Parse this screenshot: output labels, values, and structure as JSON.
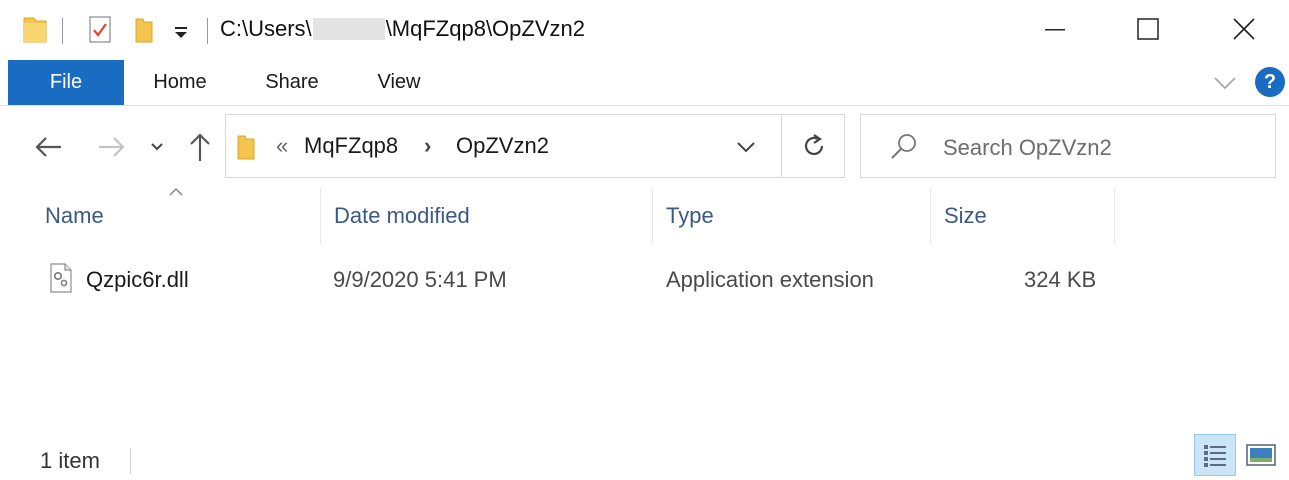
{
  "window": {
    "title_path_prefix": "C:\\Users\\",
    "title_path_suffix": "\\MqFZqp8\\OpZVzn2",
    "minimize_icon": "minimize-icon",
    "maximize_icon": "maximize-icon",
    "close_icon": "close-icon"
  },
  "ribbon": {
    "tabs": [
      {
        "label": "File",
        "active": true
      },
      {
        "label": "Home"
      },
      {
        "label": "Share"
      },
      {
        "label": "View"
      }
    ],
    "help_label": "?"
  },
  "address_bar": {
    "overflow": "«",
    "crumbs": [
      "MqFZqp8",
      "OpZVzn2"
    ],
    "separator": "›"
  },
  "search": {
    "placeholder": "Search OpZVzn2"
  },
  "columns": [
    "Name",
    "Date modified",
    "Type",
    "Size"
  ],
  "files": [
    {
      "name": "Qzpic6r.dll",
      "date_modified": "9/9/2020 5:41 PM",
      "type": "Application extension",
      "size": "324 KB",
      "icon": "dll-file-icon"
    }
  ],
  "status": {
    "item_count": "1 item"
  },
  "colors": {
    "accent": "#1a6bc2",
    "header_text": "#3b5a82",
    "folder": "#f3c54e"
  }
}
